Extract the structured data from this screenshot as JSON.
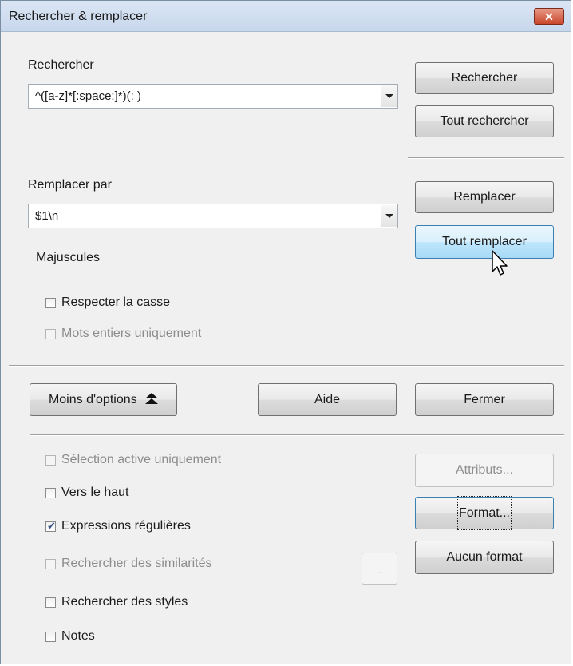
{
  "window": {
    "title": "Rechercher & remplacer",
    "close_label": "✕"
  },
  "search": {
    "label": "Rechercher",
    "value": "^([a-z]*[:space:]*)(: )"
  },
  "replace": {
    "label": "Remplacer par",
    "value": "$1\\n"
  },
  "buttons": {
    "search": "Rechercher",
    "search_all": "Tout rechercher",
    "replace": "Remplacer",
    "replace_all": "Tout remplacer",
    "fewer_options": "Moins d'options",
    "help": "Aide",
    "close": "Fermer",
    "attributes": "Attributs...",
    "format": "Format...",
    "no_format": "Aucun format",
    "similarity_dots": "..."
  },
  "case_section": {
    "label": "Majuscules"
  },
  "checkboxes": {
    "match_case": {
      "label": "Respecter la casse",
      "checked": false,
      "enabled": true
    },
    "whole_words": {
      "label": "Mots entiers uniquement",
      "checked": false,
      "enabled": false
    },
    "current_selection": {
      "label": "Sélection active uniquement",
      "checked": false,
      "enabled": false
    },
    "backwards": {
      "label": "Vers le haut",
      "checked": false,
      "enabled": true
    },
    "regex": {
      "label": "Expressions régulières",
      "checked": true,
      "enabled": true
    },
    "similarity": {
      "label": "Rechercher des similarités",
      "checked": false,
      "enabled": false
    },
    "styles": {
      "label": "Rechercher des styles",
      "checked": false,
      "enabled": true
    },
    "notes": {
      "label": "Notes",
      "checked": false,
      "enabled": true
    }
  }
}
